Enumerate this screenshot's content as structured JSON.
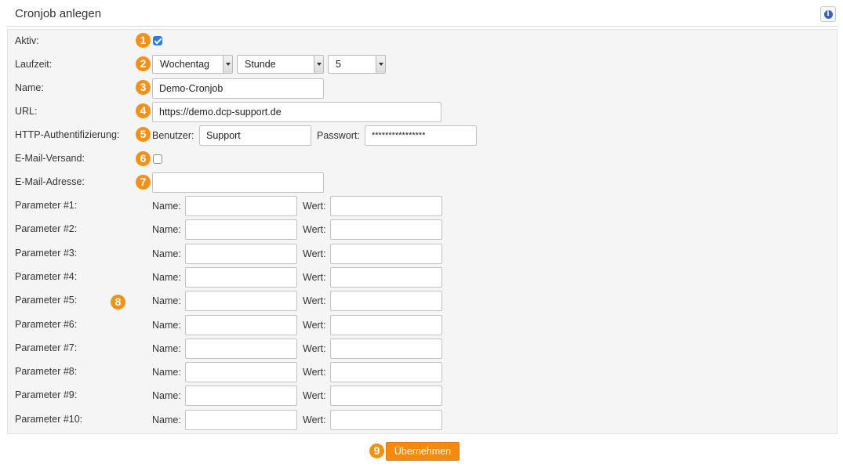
{
  "header": {
    "title": "Cronjob anlegen",
    "info_icon": "info-icon",
    "info_glyph": "i"
  },
  "badges": [
    "1",
    "2",
    "3",
    "4",
    "5",
    "6",
    "7",
    "8",
    "9"
  ],
  "form": {
    "aktiv": {
      "label": "Aktiv:",
      "checked": true
    },
    "laufzeit": {
      "label": "Laufzeit:",
      "day": "Wochentag",
      "unit": "Stunde",
      "value": "5"
    },
    "name": {
      "label": "Name:",
      "value": "Demo-Cronjob"
    },
    "url": {
      "label": "URL:",
      "value": "https://demo.dcp-support.de"
    },
    "http_auth": {
      "label": "HTTP-Authentifizierung:",
      "user_label": "Benutzer:",
      "user_value": "Support",
      "password_label": "Passwort:",
      "password_value": "****************"
    },
    "email_send": {
      "label": "E-Mail-Versand:",
      "checked": false
    },
    "email_address": {
      "label": "E-Mail-Adresse:",
      "value": ""
    },
    "param_name_label": "Name:",
    "param_value_label": "Wert:",
    "parameters": [
      {
        "label": "Parameter #1:",
        "name": "",
        "value": ""
      },
      {
        "label": "Parameter #2:",
        "name": "",
        "value": ""
      },
      {
        "label": "Parameter #3:",
        "name": "",
        "value": ""
      },
      {
        "label": "Parameter #4:",
        "name": "",
        "value": ""
      },
      {
        "label": "Parameter #5:",
        "name": "",
        "value": ""
      },
      {
        "label": "Parameter #6:",
        "name": "",
        "value": ""
      },
      {
        "label": "Parameter #7:",
        "name": "",
        "value": ""
      },
      {
        "label": "Parameter #8:",
        "name": "",
        "value": ""
      },
      {
        "label": "Parameter #9:",
        "name": "",
        "value": ""
      },
      {
        "label": "Parameter #10:",
        "name": "",
        "value": ""
      }
    ]
  },
  "submit_label": "Übernehmen",
  "colors": {
    "accent": "#f48a0f",
    "badge": "#f39016",
    "checkbox": "#2f7ae5"
  }
}
